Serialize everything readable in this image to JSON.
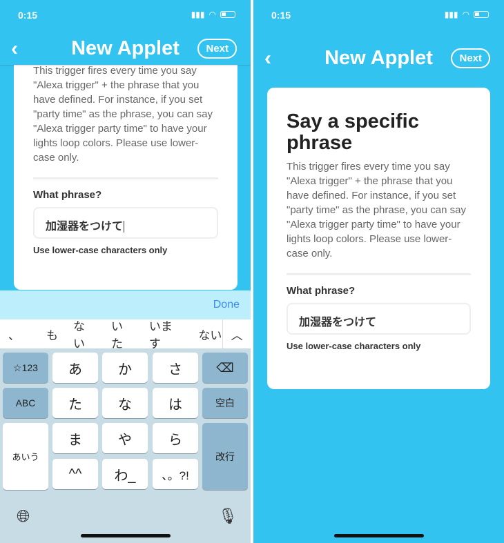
{
  "status": {
    "time": "0:15"
  },
  "header": {
    "title": "New Applet",
    "back": "‹",
    "next": "Next"
  },
  "card": {
    "heading": "Say a specific phrase",
    "description": "This trigger fires every time you say \"Alexa trigger\" + the phrase that you have defined. For instance, if you set \"party time\" as the phrase, you can say \"Alexa trigger party time\" to have your lights loop colors. Please use lower-case only.",
    "field_label": "What phrase?",
    "field_value": "加湿器をつけて",
    "hint": "Use lower-case characters only"
  },
  "keyboard": {
    "done": "Done",
    "candidates": [
      "、",
      "も",
      "ない",
      "いた",
      "います",
      "ない"
    ],
    "keys": {
      "sym": "☆123",
      "a": "あ",
      "ka": "か",
      "sa": "さ",
      "abc": "ABC",
      "ta": "た",
      "na": "な",
      "ha": "は",
      "space": "空白",
      "kana": "あいう",
      "ma": "ま",
      "ya": "や",
      "ra": "ら",
      "enter": "改行",
      "emoji": "^^",
      "wa": "わ_",
      "punct": "、。?!"
    }
  }
}
